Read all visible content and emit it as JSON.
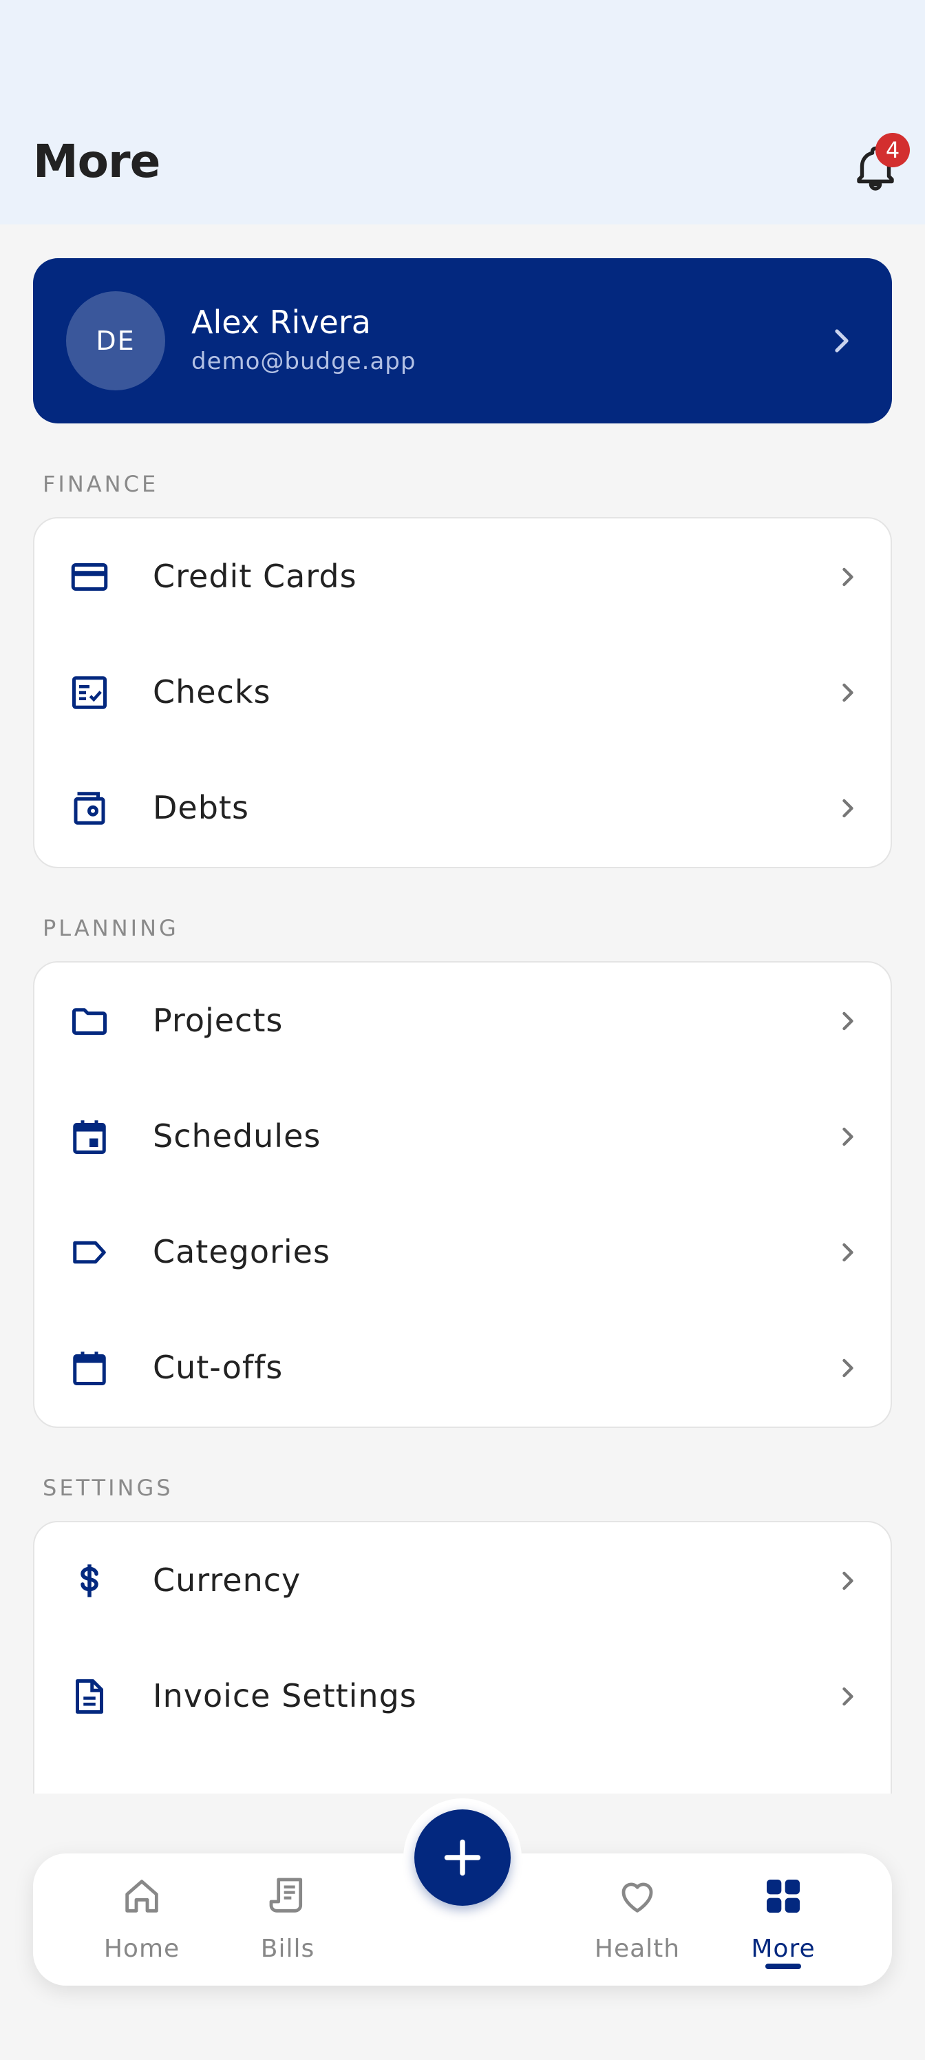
{
  "header": {
    "title": "More",
    "notification_count": "4"
  },
  "profile": {
    "initials": "DE",
    "name": "Alex Rivera",
    "email": "demo@budge.app"
  },
  "sections": {
    "finance": {
      "label": "FINANCE",
      "items": [
        {
          "label": "Credit Cards",
          "icon": "credit-card-icon"
        },
        {
          "label": "Checks",
          "icon": "checklist-icon"
        },
        {
          "label": "Debts",
          "icon": "wallet-icon"
        }
      ]
    },
    "planning": {
      "label": "PLANNING",
      "items": [
        {
          "label": "Projects",
          "icon": "folder-icon"
        },
        {
          "label": "Schedules",
          "icon": "calendar-event-icon"
        },
        {
          "label": "Categories",
          "icon": "tag-icon"
        },
        {
          "label": "Cut-offs",
          "icon": "calendar-icon"
        }
      ]
    },
    "settings": {
      "label": "SETTINGS",
      "items": [
        {
          "label": "Currency",
          "icon": "dollar-icon"
        },
        {
          "label": "Invoice Settings",
          "icon": "document-icon"
        }
      ]
    }
  },
  "nav": {
    "home": "Home",
    "bills": "Bills",
    "health": "Health",
    "more": "More",
    "active": "More"
  },
  "colors": {
    "primary": "#03287f",
    "badge": "#d32f2f",
    "header_bg": "#ebf2fb"
  }
}
